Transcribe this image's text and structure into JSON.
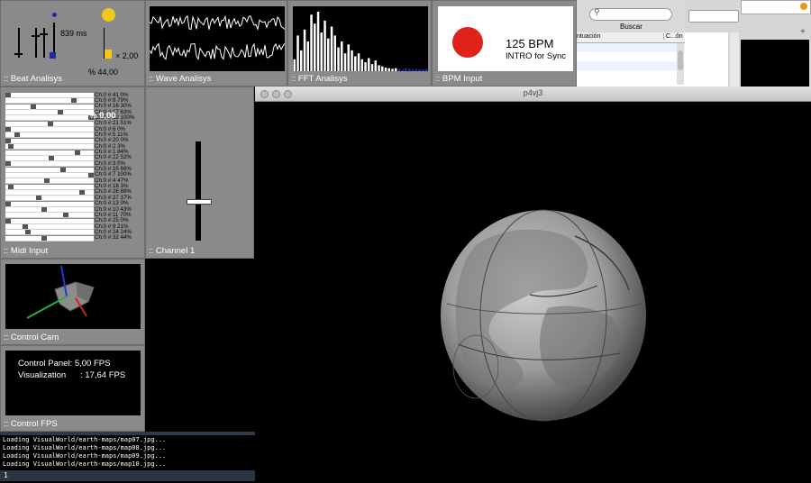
{
  "beat": {
    "label": ":: Beat Analisys",
    "ms": "839 ms",
    "multiplier": "× 2,00",
    "percent": "% 44,00",
    "indicator_color": "#f2c818",
    "fader_level": 0.3
  },
  "wave": {
    "label": ":: Wave Analisys"
  },
  "fft": {
    "label": ":: FFT Analisys",
    "bars": [
      0.2,
      0.6,
      0.35,
      0.7,
      0.5,
      0.95,
      0.8,
      1.0,
      0.65,
      0.85,
      0.55,
      0.75,
      0.6,
      0.4,
      0.5,
      0.3,
      0.45,
      0.35,
      0.25,
      0.3,
      0.2,
      0.15,
      0.22,
      0.12,
      0.18,
      0.1,
      0.08,
      0.06,
      0.05,
      0.04,
      0.05,
      0.04,
      0.03,
      0.05,
      0.04,
      0.03,
      0.04,
      0.03,
      0.03,
      0.04
    ]
  },
  "bpm": {
    "label": ":: BPM Input",
    "value": "125 BPM",
    "sub": "INTRO for Sync",
    "indicator_color": "#e0231a"
  },
  "midi": {
    "label": ":: Midi Input",
    "overlay": "0,00",
    "rows": [
      {
        "text": "Ch:0 #:41 0%",
        "level": 0.0
      },
      {
        "text": "Ch:0 #:8 79%",
        "level": 0.79
      },
      {
        "text": "Ch:0 #:16 30%",
        "level": 0.3
      },
      {
        "text": "Ch:0 #:17 63%",
        "level": 0.63
      },
      {
        "text": "Ch:0 #:12 100%",
        "level": 1.0
      },
      {
        "text": "Ch:0 #:21 51%",
        "level": 0.51
      },
      {
        "text": "Ch:0 #:6 0%",
        "level": 0.0
      },
      {
        "text": "Ch:0 #:5 11%",
        "level": 0.11
      },
      {
        "text": "Ch:0 #:20 0%",
        "level": 0.0
      },
      {
        "text": "Ch:0 #:2 3%",
        "level": 0.03
      },
      {
        "text": "Ch:0 #:1 84%",
        "level": 0.84
      },
      {
        "text": "Ch:0 #:22 52%",
        "level": 0.52
      },
      {
        "text": "Ch:0 #:3 0%",
        "level": 0.0
      },
      {
        "text": "Ch:0 #:15 66%",
        "level": 0.66
      },
      {
        "text": "Ch:0 #:7 100%",
        "level": 1.0
      },
      {
        "text": "Ch:0 #:4 47%",
        "level": 0.47
      },
      {
        "text": "Ch:0 #:18 3%",
        "level": 0.03
      },
      {
        "text": "Ch:0 #:26 89%",
        "level": 0.89
      },
      {
        "text": "Ch:0 #:27 37%",
        "level": 0.37
      },
      {
        "text": "Ch:0 #:13 0%",
        "level": 0.0
      },
      {
        "text": "Ch:0 #:10 43%",
        "level": 0.43
      },
      {
        "text": "Ch:0 #:11 70%",
        "level": 0.7
      },
      {
        "text": "Ch:0 #:25 0%",
        "level": 0.0
      },
      {
        "text": "Ch:0 #:9 21%",
        "level": 0.21
      },
      {
        "text": "Ch:0 #:24 24%",
        "level": 0.24
      },
      {
        "text": "Ch:0 #:32 44%",
        "level": 0.44
      }
    ]
  },
  "channel": {
    "label": ":: Channel 1",
    "level": 0.5
  },
  "cam": {
    "label": ":: Control Cam"
  },
  "fps": {
    "label": ":: Control FPS",
    "line1": "Control Panel: 5,00 FPS",
    "line2": "Visualization      : 17,64 FPS"
  },
  "console": {
    "lines": [
      "Loading VisualWorld/earth-maps/map07.jpg...",
      "Loading VisualWorld/earth-maps/map08.jpg...",
      "Loading VisualWorld/earth-maps/map09.jpg...",
      "Loading VisualWorld/earth-maps/map10.jpg..."
    ],
    "input": "1"
  },
  "window": {
    "title": "p4vj3"
  },
  "finder": {
    "search_label": "Buscar",
    "col1": "ntuación",
    "col2": "C...ón"
  }
}
